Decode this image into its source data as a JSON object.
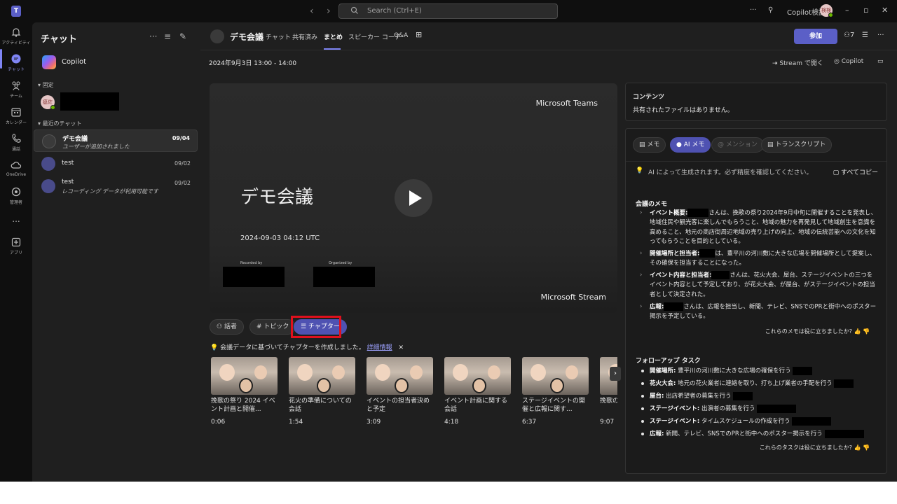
{
  "titlebar": {
    "search_placeholder": "Search (Ctrl+E)",
    "account_name": "Copilot検証",
    "avatar_initials": "検検"
  },
  "rail": {
    "items": [
      {
        "label": "アクティビティ",
        "icon": "bell-icon"
      },
      {
        "label": "チャット",
        "icon": "chat-icon"
      },
      {
        "label": "チーム",
        "icon": "teams-icon"
      },
      {
        "label": "カレンダー",
        "icon": "calendar-icon"
      },
      {
        "label": "通話",
        "icon": "phone-icon"
      },
      {
        "label": "OneDrive",
        "icon": "cloud-icon"
      },
      {
        "label": "管理者",
        "icon": "admin-icon"
      },
      {
        "label": "...",
        "icon": "more-icon"
      },
      {
        "label": "アプリ",
        "icon": "apps-icon"
      }
    ]
  },
  "chatpanel": {
    "title": "チャット",
    "copilot_label": "Copilot",
    "pinned_header": "固定",
    "pinned_avatar_initials": "瘟佐",
    "recent_header": "最近のチャット",
    "chats": [
      {
        "name": "デモ会議",
        "subtitle": "ユーザーが追加されました",
        "date": "09/04"
      },
      {
        "name": "test",
        "subtitle": "",
        "date": "09/02"
      },
      {
        "name": "test",
        "subtitle": "レコーディング データが利用可能です",
        "date": "09/02"
      }
    ]
  },
  "header": {
    "meeting_title": "デモ会議",
    "tabs": [
      "チャット",
      "共有済み",
      "まとめ",
      "スピーカー コーチ",
      "Q&A"
    ],
    "join_label": "参加",
    "participants_count": "7"
  },
  "subheader": {
    "date_range": "2024年9月3日 13:00 - 14:00",
    "open_stream": "Stream で開く",
    "copilot": "Copilot"
  },
  "video": {
    "brand_top": "Microsoft Teams",
    "title": "デモ会議",
    "timestamp": "2024-09-03 04:12 UTC",
    "recorded_by": "Recorded by",
    "organized_by": "Organized by",
    "brand_bottom": "Microsoft Stream"
  },
  "filters": {
    "speakers": "話者",
    "topics": "トピック",
    "chapters": "チャプター"
  },
  "chapters_info": {
    "text": "会議データに基づいてチャプターを作成しました。",
    "link": "詳細情報"
  },
  "chapters": [
    {
      "caption": "挽歌の祭り 2024 イベント計画と開催...",
      "time": "0:06"
    },
    {
      "caption": "花火の準備についての会話",
      "time": "1:54"
    },
    {
      "caption": "イベントの担当者決めと予定",
      "time": "3:09"
    },
    {
      "caption": "イベント計画に関する会話",
      "time": "4:18"
    },
    {
      "caption": "ステージイベントの開催と広報に関す...",
      "time": "6:37"
    },
    {
      "caption": "挽歌の祭りに関する...",
      "time": "9:07"
    }
  ],
  "contents": {
    "title": "コンテンツ",
    "body": "共有されたファイルはありません。"
  },
  "notes": {
    "tabs": [
      "メモ",
      "AI メモ",
      "メンション",
      "トランスクリプト"
    ],
    "ai_notice": "AI によって生成されます。必ず精度を確認してください。",
    "copy_all": "すべてコピー",
    "meeting_notes_title": "会議のメモ",
    "meeting_notes": [
      {
        "label": "イベント概要:",
        "text": "さんは、挽歌の祭り2024年9月中旬に開催することを発表し、地域住民や観光客に楽しんでもらうこと、地域の魅力を再発見して地域創生を意識を高めること、地元の商店街周辺地域の売り上げの向上、地域の伝統芸能への文化を知ってもらうことを目的としている。"
      },
      {
        "label": "開催場所と担当者:",
        "text": "は、豊平川の河川敷に大きな広場を開催場所として提案し、その確保を担当することになった。"
      },
      {
        "label": "イベント内容と担当者:",
        "text": "さんは、花火大会、屋台、ステージイベントの三つをイベント内容として予定しており、が花火大会、が屋台、がステージイベントの担当者として決定された。"
      },
      {
        "label": "広報:",
        "text": "さんは、広報を担当し、新聞、テレビ、SNSでのPRと街中へのポスター掲示を予定している。"
      }
    ],
    "feedback_notes": "これらのメモは役に立ちましたか?",
    "followup_title": "フォローアップ タスク",
    "tasks": [
      {
        "label": "開催場所:",
        "text": "豊平川の河川敷に大きな広場の確保を行う"
      },
      {
        "label": "花火大会:",
        "text": "地元の花火業者に連絡を取り、打ち上げ業者の手配を行う"
      },
      {
        "label": "屋台:",
        "text": "出店希望者の募集を行う"
      },
      {
        "label": "ステージイベント:",
        "text": "出演者の募集を行う"
      },
      {
        "label": "ステージイベント:",
        "text": "タイムスケジュールの作成を行う"
      },
      {
        "label": "広報:",
        "text": "新聞、テレビ、SNSでのPRと街中へのポスター掲示を行う"
      }
    ],
    "feedback_tasks": "これらのタスクは役に立ちましたか?"
  },
  "colors": {
    "accent": "#5b5fc7",
    "highlight_box": "#e0101d",
    "background": "#1f1f1f"
  }
}
